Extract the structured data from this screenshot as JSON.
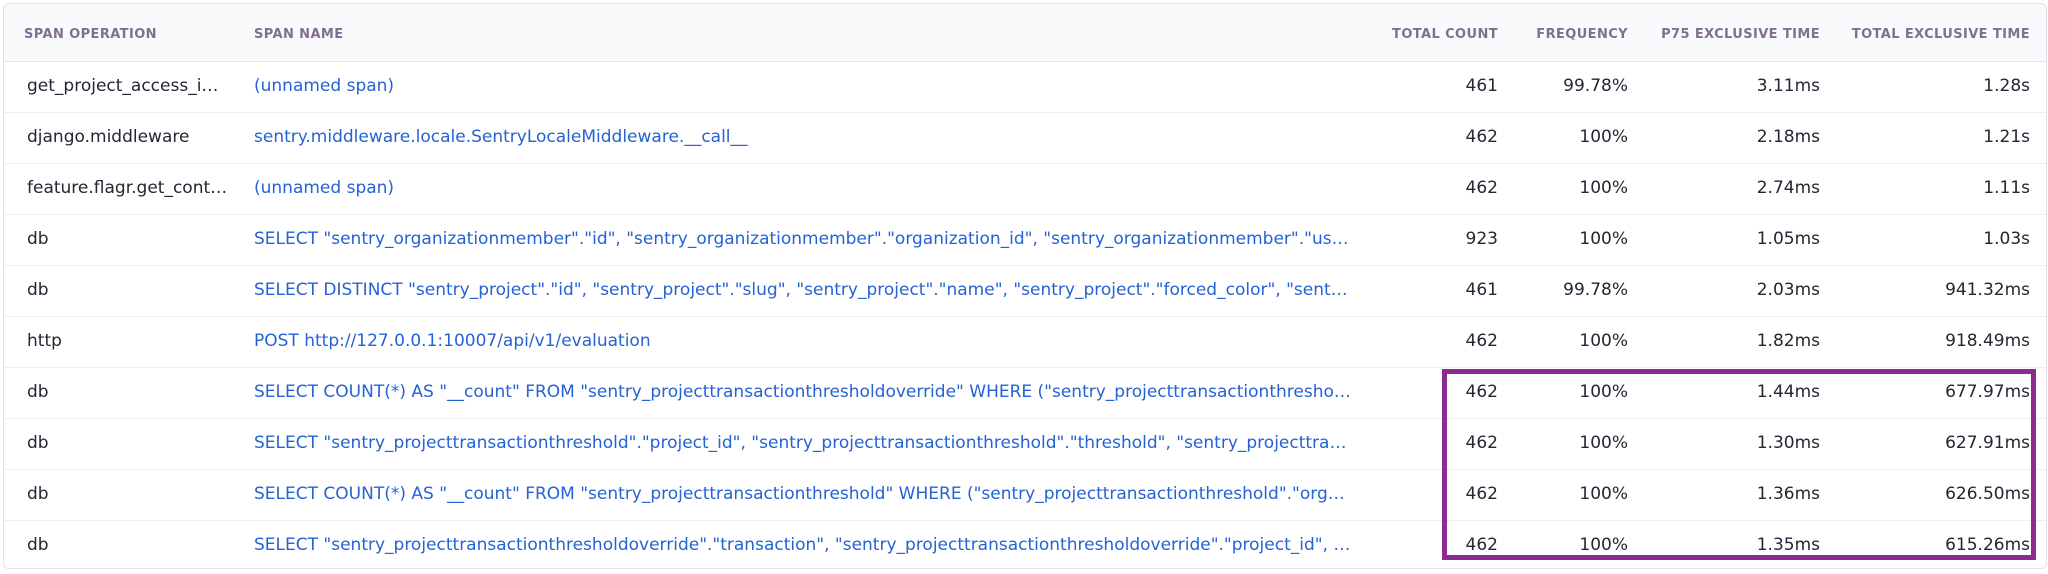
{
  "table": {
    "columns": {
      "span_operation": "SPAN OPERATION",
      "span_name": "SPAN NAME",
      "total_count": "TOTAL COUNT",
      "frequency": "FREQUENCY",
      "p75_exclusive_time": "P75 EXCLUSIVE TIME",
      "total_exclusive_time": "TOTAL EXCLUSIVE TIME"
    },
    "rows": [
      {
        "op": "get_project_access_i…",
        "name": "(unnamed span)",
        "count": "461",
        "freq": "99.78%",
        "p75": "3.11ms",
        "total": "1.28s"
      },
      {
        "op": "django.middleware",
        "name": "sentry.middleware.locale.SentryLocaleMiddleware.__call__",
        "count": "462",
        "freq": "100%",
        "p75": "2.18ms",
        "total": "1.21s"
      },
      {
        "op": "feature.flagr.get_conte…",
        "name": "(unnamed span)",
        "count": "462",
        "freq": "100%",
        "p75": "2.74ms",
        "total": "1.11s"
      },
      {
        "op": "db",
        "name": "SELECT \"sentry_organizationmember\".\"id\", \"sentry_organizationmember\".\"organization_id\", \"sentry_organizationmember\".\"user_id\", \"…",
        "count": "923",
        "freq": "100%",
        "p75": "1.05ms",
        "total": "1.03s"
      },
      {
        "op": "db",
        "name": "SELECT DISTINCT \"sentry_project\".\"id\", \"sentry_project\".\"slug\", \"sentry_project\".\"name\", \"sentry_project\".\"forced_color\", \"sentry_proje…",
        "count": "461",
        "freq": "99.78%",
        "p75": "2.03ms",
        "total": "941.32ms"
      },
      {
        "op": "http",
        "name": "POST http://127.0.0.1:10007/api/v1/evaluation",
        "count": "462",
        "freq": "100%",
        "p75": "1.82ms",
        "total": "918.49ms"
      },
      {
        "op": "db",
        "name": "SELECT COUNT(*) AS \"__count\" FROM \"sentry_projecttransactionthresholdoverride\" WHERE (\"sentry_projecttransactionthresholdov…",
        "count": "462",
        "freq": "100%",
        "p75": "1.44ms",
        "total": "677.97ms"
      },
      {
        "op": "db",
        "name": "SELECT \"sentry_projecttransactionthreshold\".\"project_id\", \"sentry_projecttransactionthreshold\".\"threshold\", \"sentry_projecttransact…",
        "count": "462",
        "freq": "100%",
        "p75": "1.30ms",
        "total": "627.91ms"
      },
      {
        "op": "db",
        "name": "SELECT COUNT(*) AS \"__count\" FROM \"sentry_projecttransactionthreshold\" WHERE (\"sentry_projecttransactionthreshold\".\"organiza…",
        "count": "462",
        "freq": "100%",
        "p75": "1.36ms",
        "total": "626.50ms"
      },
      {
        "op": "db",
        "name": "SELECT \"sentry_projecttransactionthresholdoverride\".\"transaction\", \"sentry_projecttransactionthresholdoverride\".\"project_id\", \"sentr…",
        "count": "462",
        "freq": "100%",
        "p75": "1.35ms",
        "total": "615.26ms"
      }
    ]
  },
  "colors": {
    "link": "#2562d4",
    "header_text": "#80708f",
    "highlight_border": "#8e2b93"
  }
}
